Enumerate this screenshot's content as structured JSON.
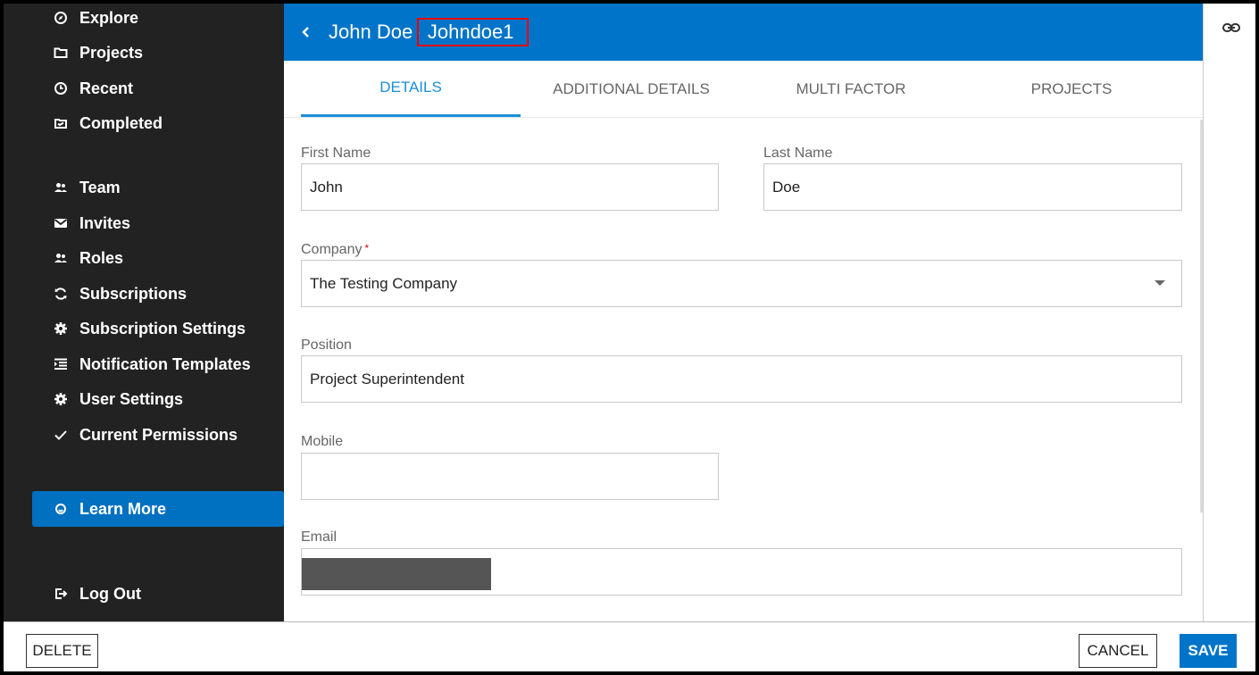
{
  "sidebar": {
    "items": [
      {
        "label": "Explore",
        "icon": "compass-icon"
      },
      {
        "label": "Projects",
        "icon": "folder-icon"
      },
      {
        "label": "Recent",
        "icon": "clock-icon"
      },
      {
        "label": "Completed",
        "icon": "archive-icon"
      },
      {
        "label": "Team",
        "icon": "people-icon"
      },
      {
        "label": "Invites",
        "icon": "envelope-icon"
      },
      {
        "label": "Roles",
        "icon": "people-icon"
      },
      {
        "label": "Subscriptions",
        "icon": "refresh-icon"
      },
      {
        "label": "Subscription Settings",
        "icon": "gear-icon"
      },
      {
        "label": "Notification Templates",
        "icon": "template-icon"
      },
      {
        "label": "User Settings",
        "icon": "gear-icon"
      },
      {
        "label": "Current Permissions",
        "icon": "check-icon"
      },
      {
        "label": "Learn More",
        "icon": "smile-icon"
      },
      {
        "label": "Log Out",
        "icon": "logout-icon"
      }
    ]
  },
  "header": {
    "name": "John Doe",
    "separator": "·",
    "username": "Johndoe1"
  },
  "tabs": [
    "DETAILS",
    "ADDITIONAL DETAILS",
    "MULTI FACTOR",
    "PROJECTS"
  ],
  "form": {
    "first_name": {
      "label": "First Name",
      "value": "John"
    },
    "last_name": {
      "label": "Last Name",
      "value": "Doe"
    },
    "company": {
      "label": "Company",
      "required_mark": "*",
      "value": "The Testing Company"
    },
    "position": {
      "label": "Position",
      "value": "Project Superintendent"
    },
    "mobile": {
      "label": "Mobile",
      "value": ""
    },
    "email": {
      "label": "Email",
      "value": ""
    }
  },
  "footer": {
    "delete_label": "DELETE",
    "cancel_label": "CANCEL",
    "save_label": "SAVE"
  },
  "colors": {
    "sidebar_bg": "#222222",
    "accent": "#0074c8",
    "active_tab": "#1a8ed8",
    "required": "#dd0000",
    "highlight_box": "#ee0000"
  }
}
